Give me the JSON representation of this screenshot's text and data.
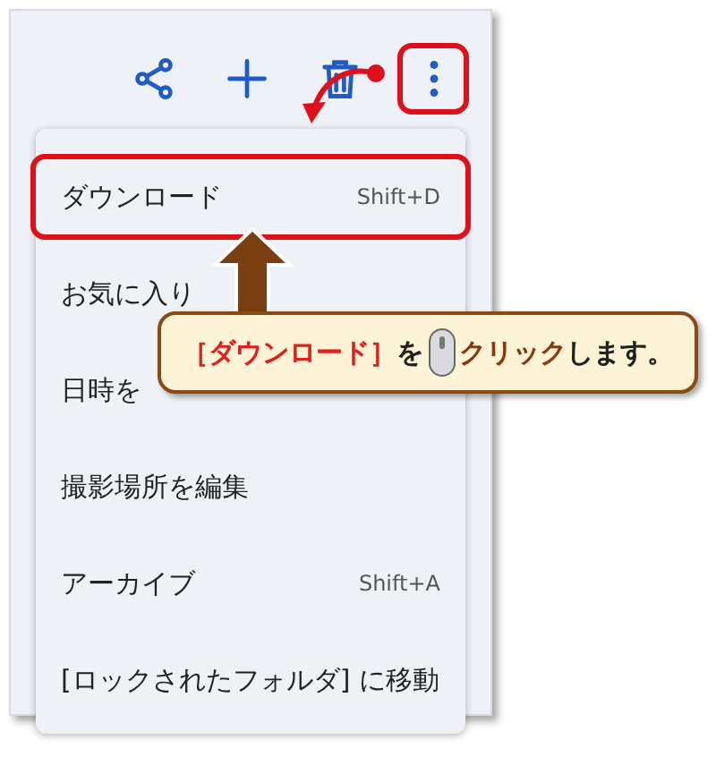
{
  "toolbar": [
    {
      "kind": "share",
      "highlighted": false
    },
    {
      "kind": "add",
      "highlighted": false
    },
    {
      "kind": "delete",
      "highlighted": false
    },
    {
      "kind": "more",
      "highlighted": true
    }
  ],
  "menu": {
    "items": [
      {
        "label": "ダウンロード",
        "shortcut": "Shift+D",
        "highlighted": true
      },
      {
        "label": "お気に入り",
        "highlighted": false
      },
      {
        "label": "日時を",
        "highlighted": false
      },
      {
        "label": "撮影場所を編集",
        "highlighted": false
      },
      {
        "label": "アーカイブ",
        "shortcut": "Shift+A",
        "highlighted": false
      },
      {
        "label": "[ロックされたフォルダ] に移動",
        "highlighted": false
      }
    ]
  },
  "callout": {
    "before": [
      {
        "text": "［ダウンロード］",
        "kind": "target"
      },
      {
        "text": "を",
        "kind": "plain"
      }
    ],
    "after": [
      {
        "text": "クリック",
        "kind": "action"
      },
      {
        "text": "します。",
        "kind": "plain"
      }
    ]
  }
}
